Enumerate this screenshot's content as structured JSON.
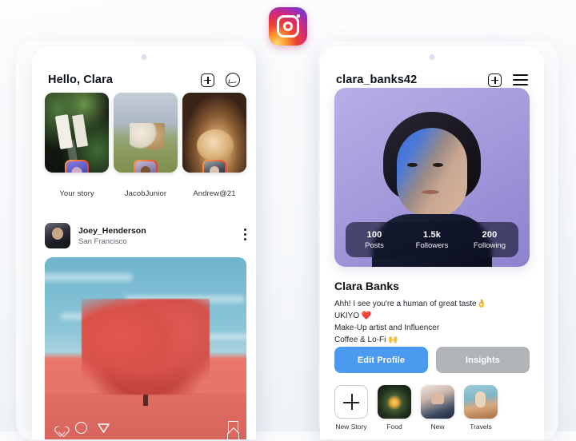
{
  "app": {
    "logo_name": "instagram-logo"
  },
  "feed_phone": {
    "header": {
      "greeting": "Hello, Clara",
      "add_icon": "plus-square-icon",
      "messenger_icon": "messenger-icon"
    },
    "stories": [
      {
        "label": "Your story",
        "thumb": "herbs-photo",
        "avatar": "clara-avatar"
      },
      {
        "label": "JacobJunior",
        "thumb": "sunflower-field-photo",
        "avatar": "jacob-avatar"
      },
      {
        "label": "Andrew@21",
        "thumb": "latte-art-photo",
        "avatar": "andrew-avatar"
      }
    ],
    "post": {
      "username": "Joey_Henderson",
      "location": "San Francisco",
      "more_icon": "more-options-icon",
      "image_name": "red-tree-photo",
      "actions": {
        "like": "heart-icon",
        "comment": "comment-bubble-icon",
        "share": "share-plane-icon",
        "save": "bookmark-icon"
      }
    }
  },
  "profile_phone": {
    "header": {
      "username": "clara_banks42",
      "add_icon": "plus-square-icon",
      "menu_icon": "hamburger-menu-icon"
    },
    "photo_name": "clara-profile-photo",
    "stats": [
      {
        "value": "100",
        "label": "Posts"
      },
      {
        "value": "1.5k",
        "label": "Followers"
      },
      {
        "value": "200",
        "label": "Following"
      }
    ],
    "bio": {
      "full_name": "Clara Banks",
      "lines": [
        "Ahh! I see you're a human of great taste👌",
        "UKIYO ❤️",
        "Make-Up artist and Influencer",
        "Coffee & Lo-Fi 🙌"
      ]
    },
    "buttons": {
      "edit_profile": "Edit Profile",
      "insights": "Insights",
      "edit_profile_color": "#4a9bf0",
      "insights_color": "#b0b4b9"
    },
    "highlights": [
      {
        "label": "New Story",
        "icon": "add-highlight-icon"
      },
      {
        "label": "Food",
        "icon": "food-highlight-cover"
      },
      {
        "label": "New",
        "icon": "new-highlight-cover"
      },
      {
        "label": "Travels",
        "icon": "travels-highlight-cover"
      }
    ]
  }
}
